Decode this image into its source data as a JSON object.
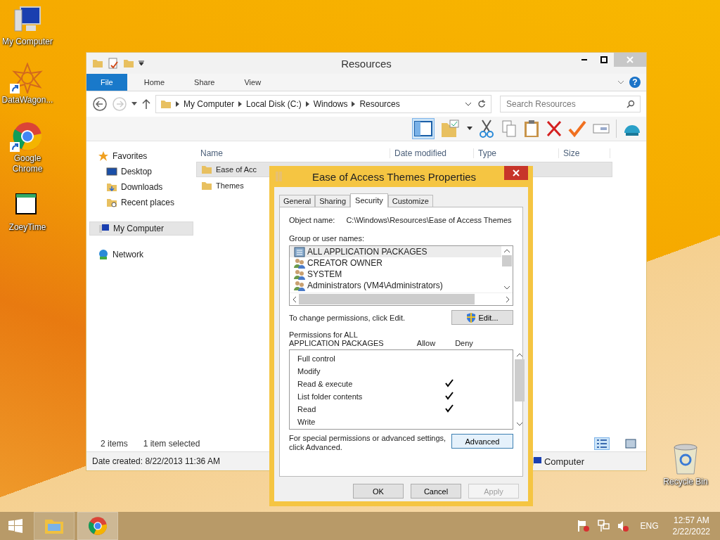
{
  "desktop_icons": [
    {
      "label": "My Computer",
      "kind": "computer",
      "shortcut": false
    },
    {
      "label": "DataWagon...",
      "kind": "star",
      "shortcut": true
    },
    {
      "label": "Google Chrome",
      "kind": "chrome",
      "shortcut": true
    },
    {
      "label": "ZoeyTime",
      "kind": "window",
      "shortcut": false
    }
  ],
  "recycle_bin": {
    "label": "Recycle Bin"
  },
  "explorer": {
    "title": "Resources",
    "ribbon_tabs": [
      {
        "label": "File",
        "kind": "file"
      },
      {
        "label": "Home",
        "kind": "tab"
      },
      {
        "label": "Share",
        "kind": "tab"
      },
      {
        "label": "View",
        "kind": "tab"
      }
    ],
    "help_label": "?",
    "address": [
      "My Computer",
      "Local Disk (C:)",
      "Windows",
      "Resources"
    ],
    "search": {
      "placeholder": "Search Resources"
    },
    "nav": [
      {
        "label": "Favorites",
        "kind": "favorites",
        "selected": false,
        "children": [
          {
            "label": "Desktop",
            "kind": "desktop",
            "selected": false
          },
          {
            "label": "Downloads",
            "kind": "downloads",
            "selected": false
          },
          {
            "label": "Recent places",
            "kind": "recent",
            "selected": false
          }
        ]
      },
      {
        "label": "My Computer",
        "kind": "computer",
        "selected": true
      },
      {
        "label": "Network",
        "kind": "network",
        "selected": false
      }
    ],
    "columns": [
      "Name",
      "Date modified",
      "Type",
      "Size"
    ],
    "rows": [
      {
        "name": "Ease of Acc",
        "selected": true
      },
      {
        "name": "Themes",
        "selected": false
      }
    ],
    "item_count": "2 items",
    "selection_count": "1 item selected",
    "details": "Date created: 8/22/2013 11:36 AM",
    "location": "Computer"
  },
  "dialog": {
    "title": "Ease of Access Themes Properties",
    "tabs": [
      {
        "label": "General",
        "selected": false
      },
      {
        "label": "Sharing",
        "selected": false
      },
      {
        "label": "Security",
        "selected": true
      },
      {
        "label": "Customize",
        "selected": false
      }
    ],
    "object_label": "Object name:",
    "object_value": "C:\\Windows\\Resources\\Ease of Access Themes",
    "groups_label": "Group or user names:",
    "groups": [
      {
        "name": "ALL APPLICATION PACKAGES",
        "kind": "package",
        "selected": true
      },
      {
        "name": "CREATOR OWNER",
        "kind": "users",
        "selected": false
      },
      {
        "name": "SYSTEM",
        "kind": "users",
        "selected": false
      },
      {
        "name": "Administrators (VM4\\Administrators)",
        "kind": "users",
        "selected": false
      }
    ],
    "edit_hint": "To change permissions, click Edit.",
    "edit_button": "Edit...",
    "permissions_label": "Permissions for ALL APPLICATION PACKAGES",
    "allow_header": "Allow",
    "deny_header": "Deny",
    "permissions": [
      {
        "name": "Full control",
        "allow": false,
        "deny": false
      },
      {
        "name": "Modify",
        "allow": false,
        "deny": false
      },
      {
        "name": "Read & execute",
        "allow": true,
        "deny": false
      },
      {
        "name": "List folder contents",
        "allow": true,
        "deny": false
      },
      {
        "name": "Read",
        "allow": true,
        "deny": false
      },
      {
        "name": "Write",
        "allow": false,
        "deny": false
      }
    ],
    "advanced_hint": "For special permissions or advanced settings, click Advanced.",
    "advanced_button": "Advanced",
    "buttons": [
      {
        "label": "OK",
        "disabled": false
      },
      {
        "label": "Cancel",
        "disabled": false
      },
      {
        "label": "Apply",
        "disabled": true
      }
    ]
  },
  "taskbar": {
    "apps": [
      {
        "kind": "explorer",
        "selected": false
      },
      {
        "kind": "chrome",
        "selected": true
      }
    ],
    "language": "ENG",
    "time": "12:57 AM",
    "date": "2/22/2022"
  }
}
